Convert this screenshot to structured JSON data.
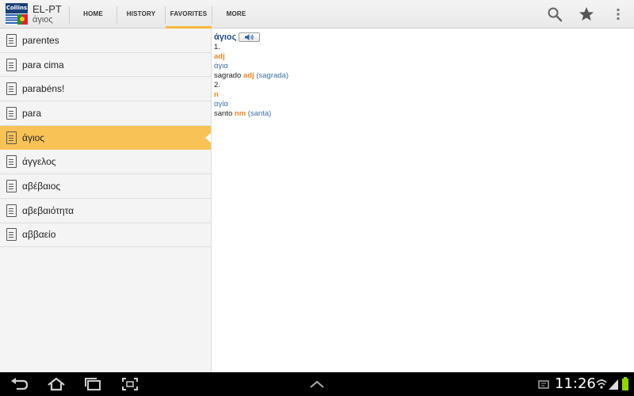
{
  "app": {
    "logo_text": "Collins",
    "title": "EL-PT",
    "subtitle": "άγιος"
  },
  "tabs": [
    {
      "label": "HOME",
      "active": false
    },
    {
      "label": "HISTORY",
      "active": false
    },
    {
      "label": "FAVORITES",
      "active": true
    },
    {
      "label": "MORE",
      "active": false
    }
  ],
  "action_icons": [
    "search-icon",
    "star-icon",
    "overflow-menu-icon"
  ],
  "favorites": [
    {
      "label": "parentes",
      "selected": false
    },
    {
      "label": "para cima",
      "selected": false
    },
    {
      "label": "parabéns!",
      "selected": false
    },
    {
      "label": "para",
      "selected": false
    },
    {
      "label": "άγιος",
      "selected": true
    },
    {
      "label": "άγγελος",
      "selected": false
    },
    {
      "label": "αβέβαιος",
      "selected": false
    },
    {
      "label": "αβεβαιότητα",
      "selected": false
    },
    {
      "label": "αββαείο",
      "selected": false
    }
  ],
  "entry": {
    "headword": "άγιος",
    "senses": [
      {
        "number": "1.",
        "pos": "adj",
        "greek": "άγια",
        "translation": "sagrado",
        "translation_pos": "adj",
        "variant": "(sagrada)"
      },
      {
        "number": "2.",
        "pos": "n",
        "greek": "αγία",
        "translation": "santo",
        "translation_pos": "nm",
        "variant": "(santa)"
      }
    ]
  },
  "status": {
    "time": "11:26"
  },
  "colors": {
    "accent": "#f6b83c",
    "selection": "#f9c257",
    "headword": "#244f86",
    "pos": "#e8862a",
    "link": "#3b6fa5"
  }
}
